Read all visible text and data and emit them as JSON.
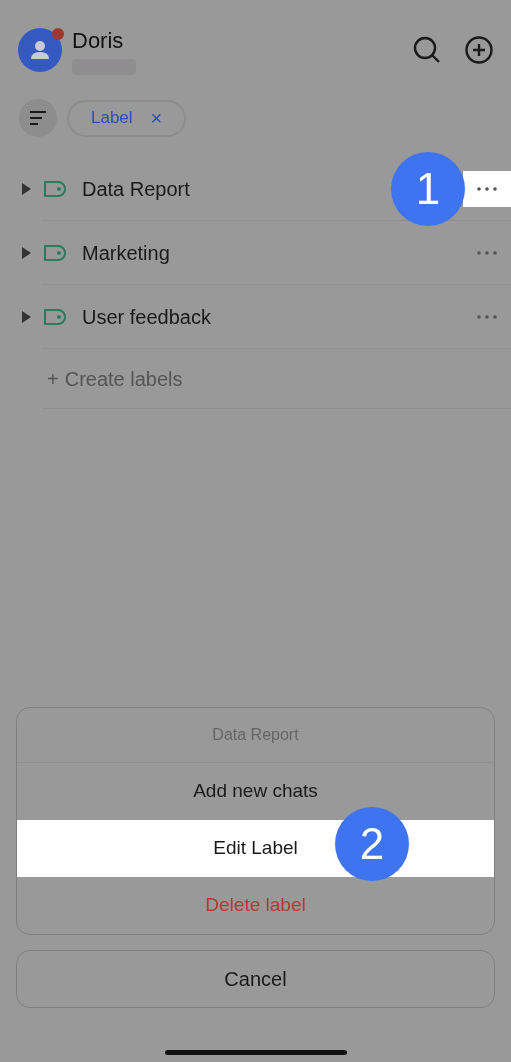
{
  "header": {
    "name": "Doris",
    "notification": true
  },
  "filter": {
    "chip": "Label",
    "close": "×"
  },
  "labels": [
    {
      "name": "Data Report",
      "selected": true,
      "step": "1"
    },
    {
      "name": "Marketing",
      "selected": false
    },
    {
      "name": "User feedback",
      "selected": false
    }
  ],
  "create": {
    "icon": "+",
    "label": "Create labels"
  },
  "action_sheet": {
    "title": "Data Report",
    "actions": [
      {
        "label": "Add new chats",
        "kind": "normal",
        "selected": false
      },
      {
        "label": "Edit Label",
        "kind": "normal",
        "selected": true,
        "step": "2"
      },
      {
        "label": "Delete label",
        "kind": "destructive",
        "selected": false
      }
    ],
    "cancel": "Cancel"
  }
}
